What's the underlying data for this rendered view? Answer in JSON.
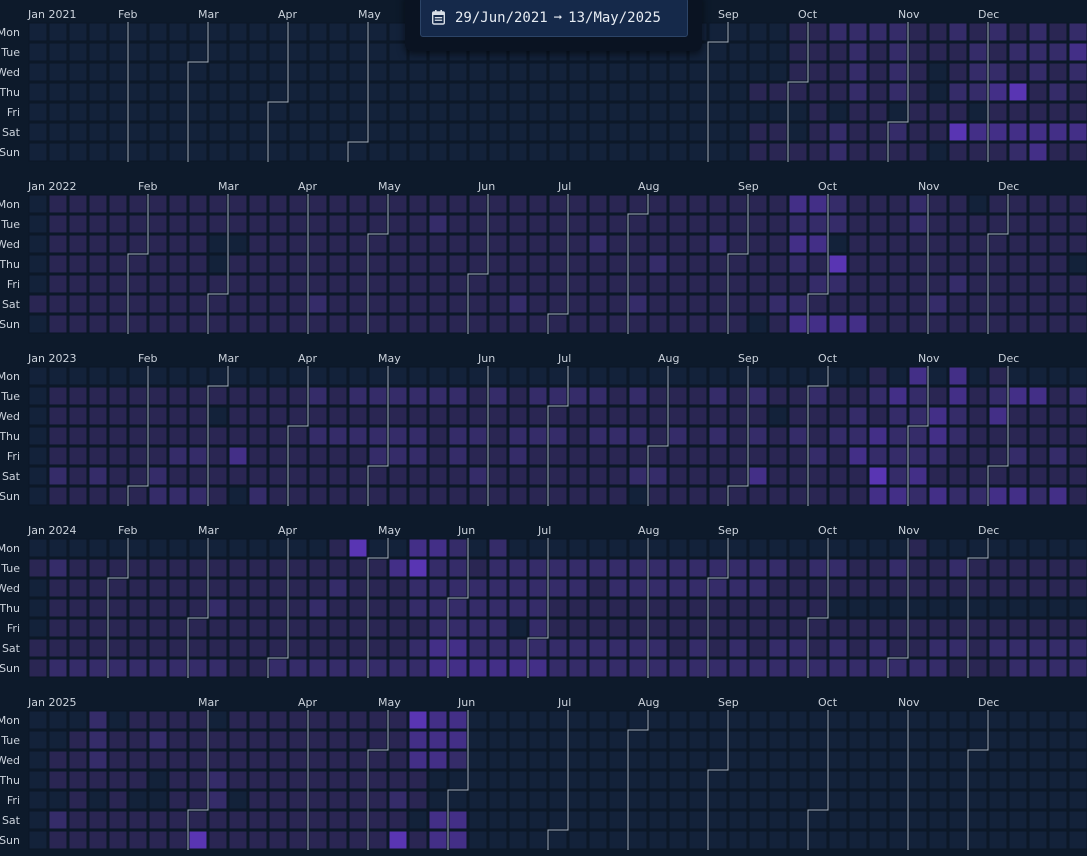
{
  "date_range": {
    "start": "29/Jun/2021",
    "separator": "➞",
    "end": "13/May/2025"
  },
  "icons": {
    "picker": "calendar-icon"
  },
  "weekday_labels": [
    "Mon",
    "Tue",
    "Wed",
    "Thu",
    "Fri",
    "Sat",
    "Sun"
  ],
  "colors": {
    "background": "#0d1a2b",
    "empty_cell": "#13223a",
    "cell_border": "#0b1626",
    "month_divider": "#a6b0bd",
    "levels": [
      "#2a2653",
      "#352c69",
      "#432f87",
      "#5935b3",
      "#8647ea"
    ]
  },
  "years": [
    {
      "label": "Jan 2021",
      "months": [
        {
          "label": "Feb",
          "week": 5
        },
        {
          "label": "Mar",
          "week": 9
        },
        {
          "label": "Apr",
          "week": 13
        },
        {
          "label": "May",
          "week": 17
        },
        {
          "label": "Sep",
          "week": 35
        },
        {
          "label": "Oct",
          "week": 39
        },
        {
          "label": "Nov",
          "week": 44
        },
        {
          "label": "Dec",
          "week": 48
        }
      ],
      "activity": [
        "00000000000000000000000000000000000000112222112121212111000",
        "00000000000000000000000000000000000000111212111212223233000",
        "00000000000000000000000000000000000000111212101221212111300",
        "00000000000000000000000000000000000011111212102234121212300",
        "00000000000000000000000000000000000000010110111011111000000",
        "00000000000000000000000000000000000011012112114333333300000",
        "00000000000000000000000000000000000011112111101112311110000"
      ]
    },
    {
      "label": "Jan 2022",
      "months": [
        {
          "label": "Feb",
          "week": 6
        },
        {
          "label": "Mar",
          "week": 10
        },
        {
          "label": "Apr",
          "week": 14
        },
        {
          "label": "May",
          "week": 18
        },
        {
          "label": "Jun",
          "week": 23
        },
        {
          "label": "Jul",
          "week": 27
        },
        {
          "label": "Aug",
          "week": 31
        },
        {
          "label": "Sep",
          "week": 36
        },
        {
          "label": "Oct",
          "week": 40
        },
        {
          "label": "Nov",
          "week": 45
        },
        {
          "label": "Dec",
          "week": 49
        }
      ],
      "activity": [
        "01111111111111111111111111111111111111332111211011111111111",
        "01111111111111111111211111111111111111222111211111111111111",
        "01111111100111111111111111112111112111330111111111111111111",
        "01111111101111111111111111111112111111214111111111110111111",
        "01111111111111111111111111111111111111122111112111111111111",
        "11111111111111211111111121111121111112211111121111111111111",
        "01111111111111111111111111111111111101333311111111111111111"
      ]
    },
    {
      "label": "Jan 2023",
      "months": [
        {
          "label": "Feb",
          "week": 6
        },
        {
          "label": "Mar",
          "week": 10
        },
        {
          "label": "Apr",
          "week": 14
        },
        {
          "label": "May",
          "week": 18
        },
        {
          "label": "Jun",
          "week": 23
        },
        {
          "label": "Jul",
          "week": 27
        },
        {
          "label": "Aug",
          "week": 32
        },
        {
          "label": "Sep",
          "week": 36
        },
        {
          "label": "Oct",
          "week": 40
        },
        {
          "label": "Nov",
          "week": 45
        },
        {
          "label": "Dec",
          "week": 49
        }
      ],
      "activity": [
        "00000000000000000000000000000000000000000010303010000000010",
        "01111111111111212222221212222121112121121123213123312121221",
        "01111111101111111111111111111111111110111212232131111111210",
        "01111111111111222222122122212221212121212232232111111111100",
        "01111112213111111222121121111111111111121322221112121111112",
        "02121121111111111111112111111122111131111142311111111121212",
        "01111122210211111111111111111101111111111133232233231221320"
      ]
    },
    {
      "label": "Jan 2024",
      "months": [
        {
          "label": "Feb",
          "week": 5
        },
        {
          "label": "Mar",
          "week": 9
        },
        {
          "label": "Apr",
          "week": 13
        },
        {
          "label": "May",
          "week": 18
        },
        {
          "label": "Jun",
          "week": 22
        },
        {
          "label": "Jul",
          "week": 26
        },
        {
          "label": "Aug",
          "week": 31
        },
        {
          "label": "Sep",
          "week": 35
        },
        {
          "label": "Oct",
          "week": 40
        },
        {
          "label": "Nov",
          "week": 44
        },
        {
          "label": "Dec",
          "week": 48
        }
      ],
      "activity": [
        "00000000000000014003320200000000000000000000100000000032000",
        "12111111111111111134221222222222222222122112112111111222121",
        "01111111111111121112222222221222222221111111111111111121100",
        "01111111121111211112222222111111111111110000000000000000000",
        "01111111111111111111222202111111111111111111111111111111100",
        "11111111111111111112332222222222121212212121122122222121214",
        "12222222221122222222333333222222222222222222221112222122220"
      ]
    },
    {
      "label": "Jan 2025",
      "months": [
        {
          "label": "Mar",
          "week": 9
        },
        {
          "label": "Apr",
          "week": 14
        },
        {
          "label": "May",
          "week": 18
        },
        {
          "label": "Jun",
          "week": 22
        },
        {
          "label": "Jul",
          "week": 27
        },
        {
          "label": "Aug",
          "week": 31
        },
        {
          "label": "Sep",
          "week": 35
        },
        {
          "label": "Oct",
          "week": 40
        },
        {
          "label": "Nov",
          "week": 44
        },
        {
          "label": "Dec",
          "week": 48
        }
      ],
      "activity": [
        "00020111101111111114330000000000000000000000000000000000000",
        "00121121111111111113330000000000000000000000000000000000000",
        "01121111111111111113320000000000000000000000000000000000000",
        "01111101121111111111000000000000000000000000000000000000000",
        "00101001120111111121000000000000000000000000000000000000000",
        "02111111111111111110330000000000000000000000000000000000000",
        "01111111411111111141330000000000000000000000000000000000000"
      ]
    }
  ]
}
